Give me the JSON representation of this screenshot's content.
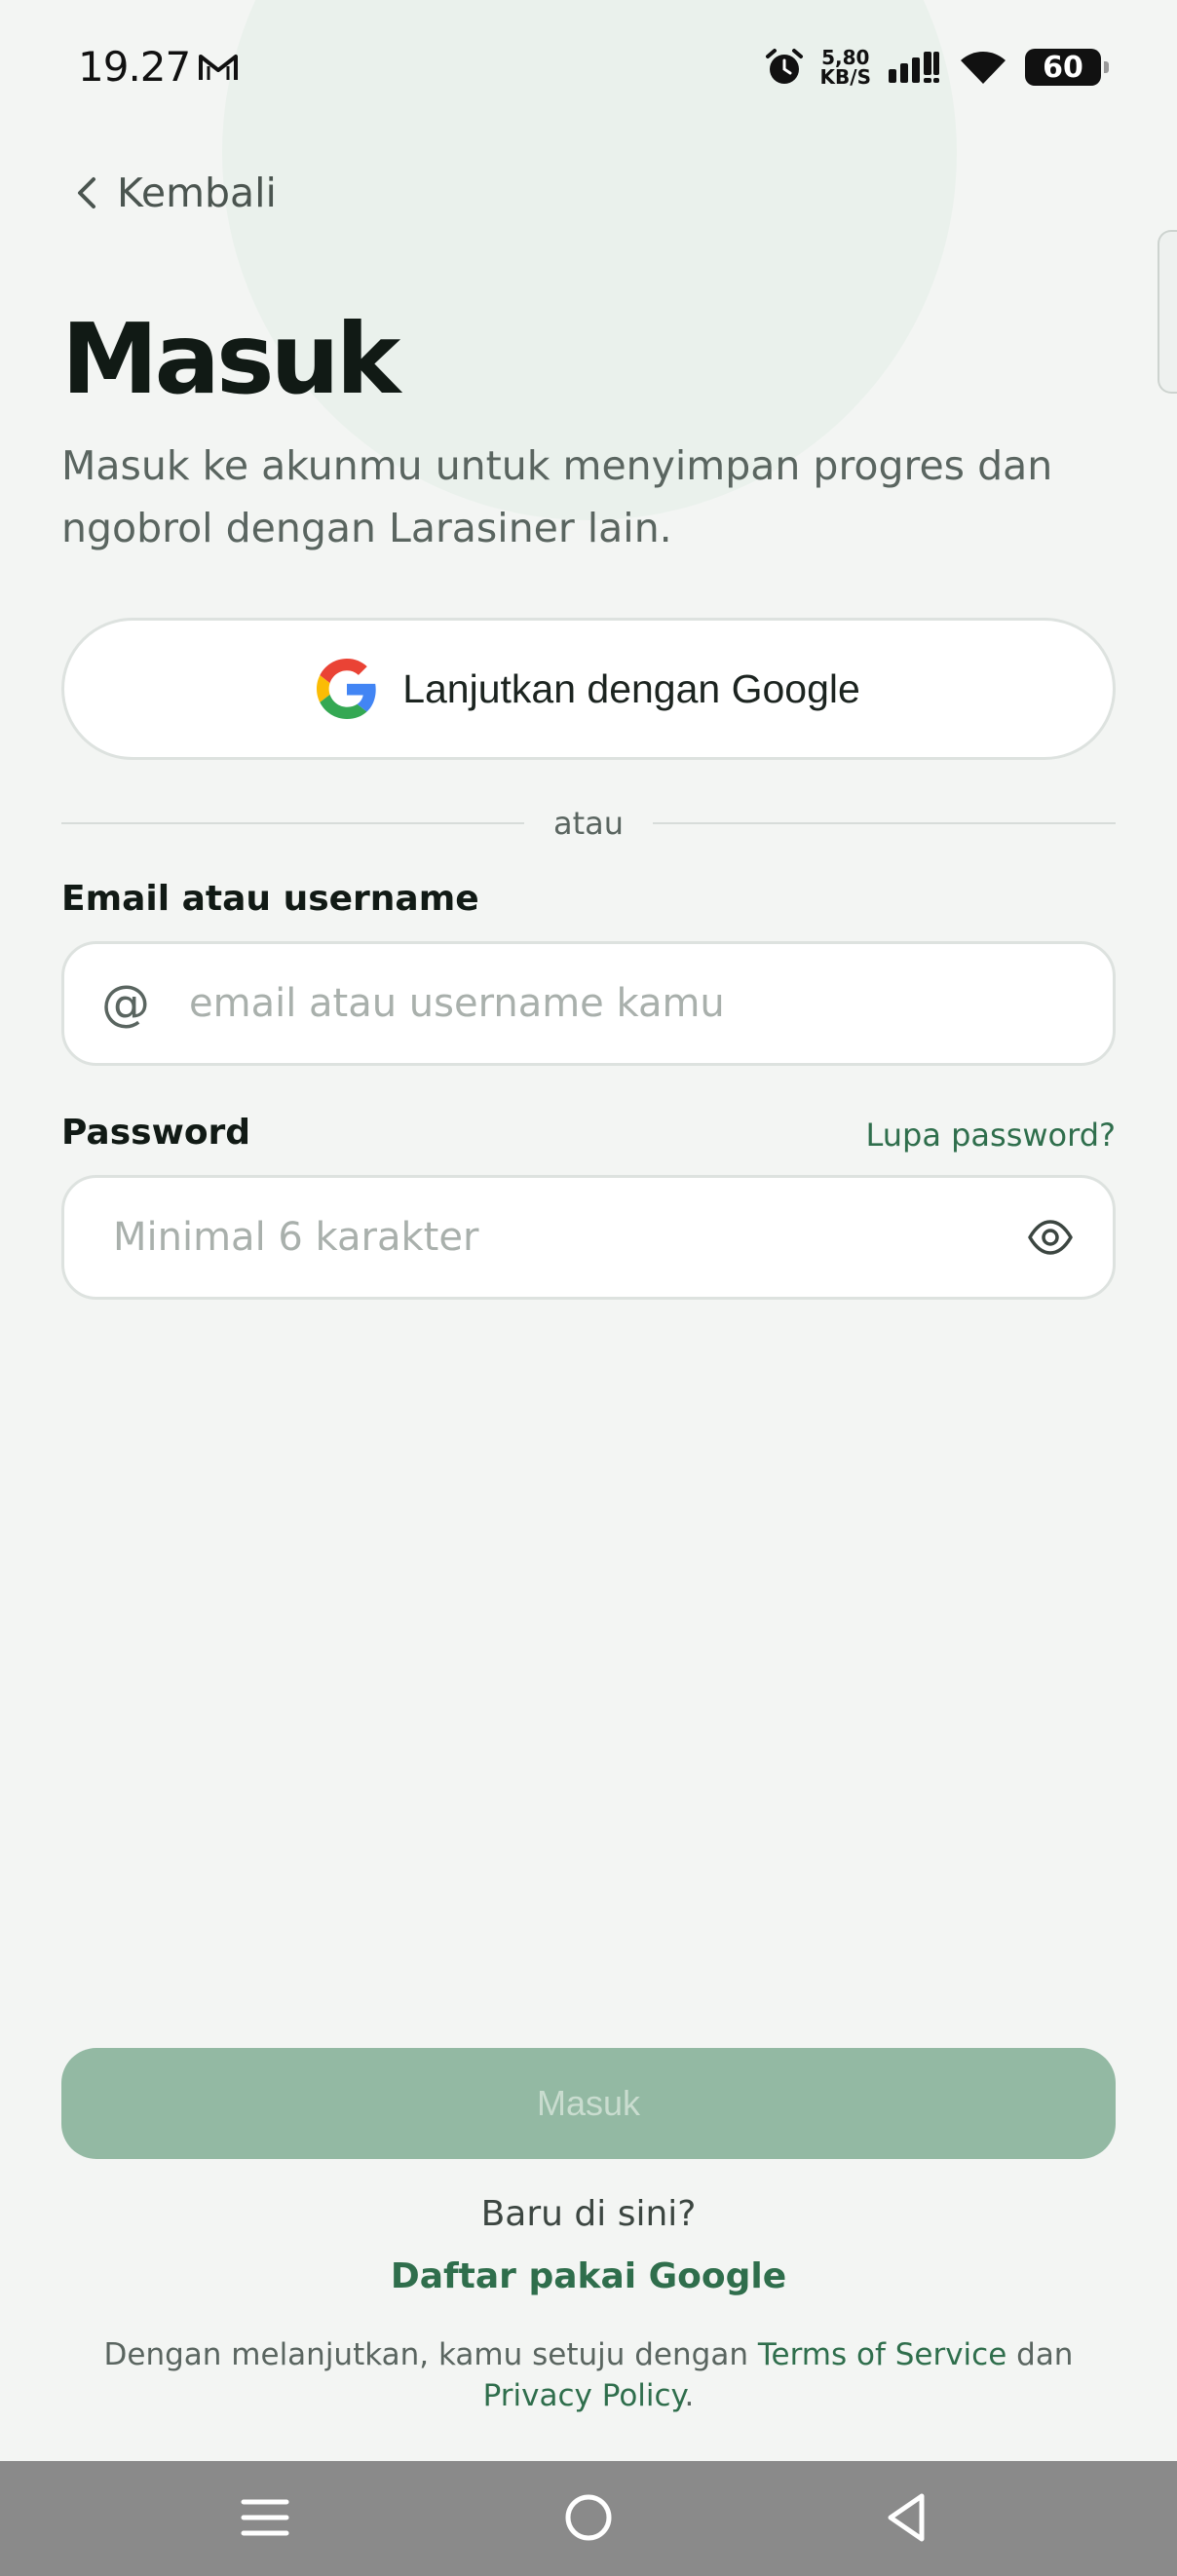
{
  "status_bar": {
    "time": "19.27",
    "network_speed_value": "5,80",
    "network_speed_unit": "KB/S",
    "battery_level": "60"
  },
  "nav": {
    "back_label": "Kembali"
  },
  "header": {
    "title": "Masuk",
    "subtitle": "Masuk ke akunmu untuk menyimpan progres dan ngobrol dengan Larasiner lain."
  },
  "google_button": {
    "label": "Lanjutkan dengan Google"
  },
  "divider": {
    "label": "atau"
  },
  "form": {
    "email_label": "Email atau username",
    "email_placeholder": "email atau username kamu",
    "email_value": "",
    "password_label": "Password",
    "password_placeholder": "Minimal 6 karakter",
    "password_value": "",
    "forgot_label": "Lupa password?"
  },
  "submit": {
    "label": "Masuk"
  },
  "footer": {
    "new_here": "Baru di sini?",
    "register_label": "Daftar pakai Google",
    "terms_prefix": "Dengan melanjutkan, kamu setuju dengan ",
    "terms_link": "Terms of Service",
    "terms_middle": " dan",
    "privacy_link": "Privacy Policy",
    "terms_suffix": "."
  },
  "colors": {
    "background": "#f3f5f3",
    "accent": "#2f6e4c",
    "submit_disabled": "#93b9a3",
    "nav_bar": "#8a8a8a"
  },
  "icons": [
    "mail-icon",
    "alarm-icon",
    "signal-icon",
    "wifi-icon",
    "battery-icon",
    "chevron-left-icon",
    "google-icon",
    "at-icon",
    "eye-icon",
    "menu-icon",
    "home-icon",
    "back-triangle-icon"
  ]
}
